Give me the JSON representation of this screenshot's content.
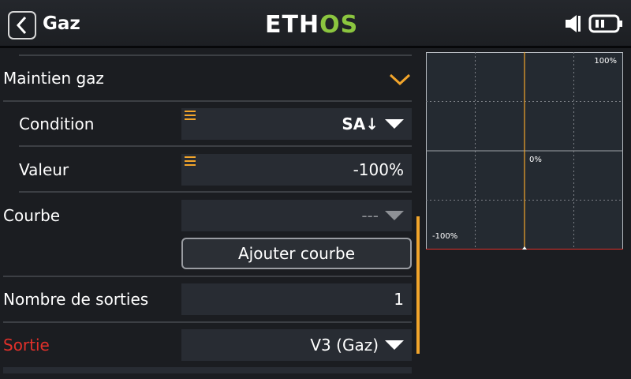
{
  "header": {
    "title": "Gaz",
    "logo_part1": "ETH",
    "logo_part2": "OS",
    "logo_colors": {
      "primary": "#ffffff",
      "accent": "#8bc53f"
    },
    "icons": [
      "back-icon",
      "speaker-icon",
      "battery-icon"
    ]
  },
  "rows": {
    "maintien": {
      "label": "Maintien gaz",
      "icon": "chevron-down-icon",
      "icon_color": "#f2a52b"
    },
    "condition": {
      "label": "Condition",
      "value": "SA↓",
      "icon": "menu-icon"
    },
    "valeur": {
      "label": "Valeur",
      "value": "-100%",
      "icon": "menu-icon"
    },
    "courbe": {
      "label": "Courbe",
      "value": "---"
    },
    "add_curve_button": "Ajouter courbe",
    "sorties": {
      "label": "Nombre de sorties",
      "value": "1"
    },
    "sortie": {
      "label": "Sortie",
      "value": "V3 (Gaz)",
      "label_color": "#e0302a"
    }
  },
  "chart": {
    "label_max": "100%",
    "label_mid": "0%",
    "label_min": "-100%"
  },
  "chart_data": {
    "type": "line",
    "xlim": [
      -100,
      100
    ],
    "ylim": [
      -100,
      100
    ],
    "grid": true,
    "series": [
      {
        "color": "#f2a52b",
        "points": [
          [
            0,
            -100
          ],
          [
            0,
            100
          ]
        ]
      },
      {
        "color": "#e0302a",
        "points": [
          [
            -100,
            -100
          ],
          [
            100,
            -100
          ]
        ]
      }
    ]
  },
  "colors": {
    "accent": "#f2a52b",
    "field_bg": "#282c33",
    "background": "#1b1d21"
  }
}
